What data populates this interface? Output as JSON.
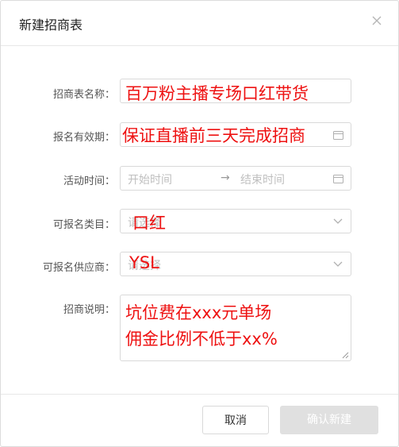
{
  "dialog": {
    "title": "新建招商表"
  },
  "form": {
    "name": {
      "label": "招商表名称：",
      "value": "百万粉主播专场口红带货"
    },
    "validity": {
      "label": "报名有效期：",
      "value": "保证直播前三天完成招商"
    },
    "activity_time": {
      "label": "活动时间：",
      "start_placeholder": "开始时间",
      "arrow": "→",
      "end_placeholder": "结束时间"
    },
    "category": {
      "label": "可报名类目：",
      "placeholder": "请选择",
      "value": "口红"
    },
    "supplier": {
      "label": "可报名供应商：",
      "placeholder": "请选择",
      "value": "YSL"
    },
    "description": {
      "label": "招商说明：",
      "line1": "坑位费在xxx元单场",
      "line2": "佣金比例不低于xx%"
    }
  },
  "footer": {
    "cancel_label": "取消",
    "confirm_label": "确认新建"
  },
  "colors": {
    "handwriting": "#ee1111",
    "border": "#d9d9d9",
    "disabled_button": "#e0e0e0"
  },
  "icons": [
    "close-icon",
    "calendar-icon",
    "chevron-down-icon",
    "resize-handle-icon"
  ]
}
